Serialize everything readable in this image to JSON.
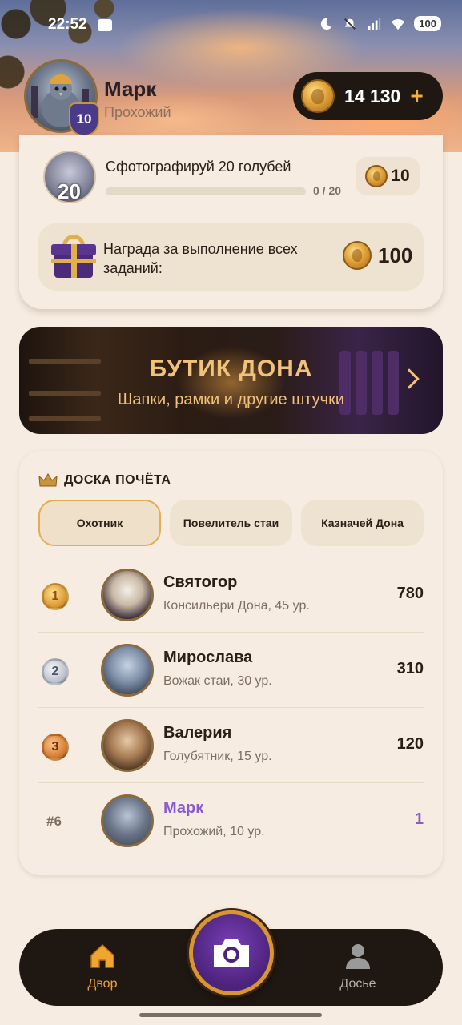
{
  "status_bar": {
    "time": "22:52",
    "battery": "100"
  },
  "profile": {
    "name": "Марк",
    "rank": "Прохожий",
    "level": "10"
  },
  "wallet": {
    "coins": "14 130",
    "plus": "+"
  },
  "task": {
    "title": "Сфотографируй 20 голубей",
    "icon_number": "20",
    "progress_text": "0 / 20",
    "progress": 0,
    "reward": "10"
  },
  "grand_reward": {
    "text": "Награда за выполнение всех заданий:",
    "amount": "100"
  },
  "boutique": {
    "title": "БУТИК ДОНА",
    "subtitle": "Шапки, рамки и другие штучки"
  },
  "leaderboard": {
    "title": "ДОСКА ПОЧЁТА",
    "tabs": [
      "Охотник",
      "Повелитель стаи",
      "Казначей Дона"
    ],
    "active_tab": 0,
    "rows": [
      {
        "medal": "1",
        "name": "Святогор",
        "subtitle": "Консильери Дона, 45 ур.",
        "score": "780"
      },
      {
        "medal": "2",
        "name": "Мирослава",
        "subtitle": "Вожак стаи, 30 ур.",
        "score": "310"
      },
      {
        "medal": "3",
        "name": "Валерия",
        "subtitle": "Голубятник, 15 ур.",
        "score": "120"
      },
      {
        "rank": "#6",
        "name": "Марк",
        "subtitle": "Прохожий, 10 ур.",
        "score": "1"
      }
    ]
  },
  "nav": {
    "home": "Двор",
    "dossier": "Досье"
  },
  "colors": {
    "accent": "#e2ad54",
    "highlight": "#8a5ad0",
    "dark": "#1e1712"
  },
  "icons": [
    "chat-icon",
    "moon-icon",
    "mute-icon",
    "signal-icon",
    "wifi-icon",
    "coin-icon",
    "gift-icon",
    "crown-icon",
    "home-icon",
    "camera-icon",
    "person-icon"
  ]
}
